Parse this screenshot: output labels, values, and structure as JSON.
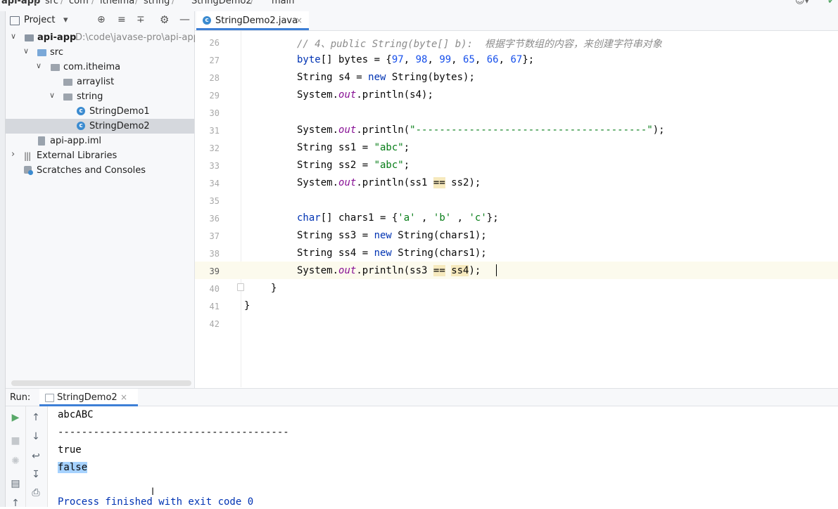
{
  "breadcrumb": {
    "items": [
      "api-app",
      "src",
      "com",
      "itheima",
      "string",
      "StringDemo2",
      "main"
    ],
    "separator": "/"
  },
  "project_panel": {
    "title": "Project",
    "dropdown_glyph": "▾",
    "toolbar_icons": [
      "target-icon",
      "expand-all-icon",
      "collapse-all-icon",
      "gear-icon",
      "minimize-icon"
    ],
    "tree": [
      {
        "label": "api-app",
        "path": "D:\\code\\javase-pro\\api-app",
        "icon": "module-folder-icon",
        "expanded": true
      },
      {
        "label": "src",
        "icon": "source-folder-icon",
        "expanded": true
      },
      {
        "label": "com.itheima",
        "icon": "package-icon",
        "expanded": true
      },
      {
        "label": "arraylist",
        "icon": "package-icon"
      },
      {
        "label": "string",
        "icon": "package-icon",
        "expanded": true
      },
      {
        "label": "StringDemo1",
        "icon": "java-class-icon"
      },
      {
        "label": "StringDemo2",
        "icon": "java-class-icon",
        "selected": true
      },
      {
        "label": "api-app.iml",
        "icon": "iml-file-icon"
      },
      {
        "label": "External Libraries",
        "icon": "libraries-icon",
        "expanded": false
      },
      {
        "label": "Scratches and Consoles",
        "icon": "scratches-icon"
      }
    ]
  },
  "editor": {
    "tab": {
      "label": "StringDemo2.java",
      "close": "×"
    },
    "current_line": 39,
    "lines": [
      {
        "n": "26"
      },
      {
        "n": "27"
      },
      {
        "n": "28"
      },
      {
        "n": "29"
      },
      {
        "n": "30"
      },
      {
        "n": "31"
      },
      {
        "n": "32"
      },
      {
        "n": "33"
      },
      {
        "n": "34"
      },
      {
        "n": "35"
      },
      {
        "n": "36"
      },
      {
        "n": "37"
      },
      {
        "n": "38"
      },
      {
        "n": "39"
      },
      {
        "n": "40"
      },
      {
        "n": "41"
      },
      {
        "n": "42"
      }
    ],
    "code": {
      "l26_comment": "// 4、public String(byte[] b):  根据字节数组的内容，来创建字符串对象",
      "l27_kw": "byte",
      "l27_rest": "[] bytes = {",
      "l27_nums": [
        "97",
        "98",
        "99",
        "65",
        "66",
        "67"
      ],
      "l27_end": "};",
      "l28": "String s4 = new String(bytes);",
      "l29_a": "System.",
      "l29_out": "out",
      "l29_b": ".println(s4);",
      "l31_str": "\"---------------------------------------\"",
      "l32_a": "String ss1 = ",
      "l32_str": "\"abc\"",
      "l33_a": "String ss2 = ",
      "l33_str": "\"abc\"",
      "l34_a": ".println(ss1 ",
      "l34_op": "==",
      "l34_b": " ss2);",
      "l36_kw": "char",
      "l36_a": "[] chars1 = {",
      "l36_c1": "'a'",
      "l36_c2": "'b'",
      "l36_c3": "'c'",
      "l36_end": "};",
      "l37_a": "String ss3 = ",
      "l37_kw": "new",
      "l37_b": " String(chars1);",
      "l38_a": "String ss4 = ",
      "l38_kw": "new",
      "l38_b": " String(chars1);",
      "l39_a": ".println(ss3 ",
      "l39_op": "==",
      "l39_ss4": "ss4",
      "l39_b": ");",
      "l40": "}",
      "l41": "}"
    }
  },
  "run_panel": {
    "label": "Run:",
    "tab": {
      "label": "StringDemo2",
      "close": "×"
    },
    "output": [
      "abcABC",
      "---------------------------------------",
      "true",
      "false",
      "",
      "Process finished with exit code 0"
    ],
    "selected_line": "false"
  }
}
